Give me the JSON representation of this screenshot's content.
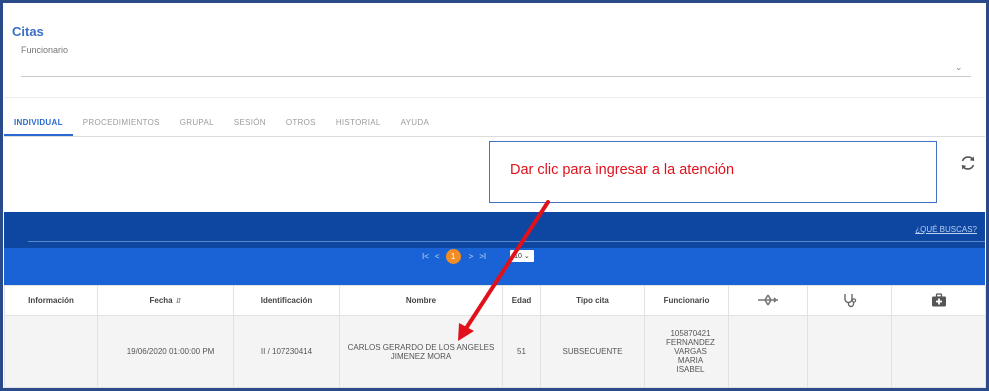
{
  "header": {
    "title": "Citas",
    "funcionario_label": "Funcionario"
  },
  "tabs": [
    {
      "label": "INDIVIDUAL",
      "active": true
    },
    {
      "label": "PROCEDIMIENTOS",
      "active": false
    },
    {
      "label": "GRUPAL",
      "active": false
    },
    {
      "label": "SESIÓN",
      "active": false
    },
    {
      "label": "OTROS",
      "active": false
    },
    {
      "label": "HISTORIAL",
      "active": false
    },
    {
      "label": "AYUDA",
      "active": false
    }
  ],
  "callout": {
    "text": "Dar clic para ingresar a la atención",
    "text_color": "#e0111b",
    "border_color": "#4472c4"
  },
  "icons": {
    "refresh": "refresh-icon",
    "plane": "plane-icon",
    "stethoscope": "stethoscope-icon",
    "medical_kit": "medical-kit-icon"
  },
  "banner": {
    "query_link": "¿QUÉ BUSCAS?",
    "color": "#0d47a1",
    "pager_color": "#1a63d6"
  },
  "pager": {
    "first": "I<",
    "prev": "<",
    "current": "1",
    "next": ">",
    "last": ">I",
    "page_size": "10",
    "accent": "#f48c24"
  },
  "table": {
    "columns": [
      "Información",
      "Fecha",
      "Identificación",
      "Nombre",
      "Edad",
      "Tipo cita",
      "Funcionario"
    ],
    "rows": [
      {
        "informacion": "",
        "fecha": "19/06/2020 01:00:00 PM",
        "identificacion": "II / 107230414",
        "nombre": "CARLOS GERARDO DE LOS ANGELES JIMENEZ MORA",
        "edad": "51",
        "tipo_cita": "SUBSECUENTE",
        "funcionario": [
          "105870421",
          "FERNANDEZ",
          "VARGAS",
          "MARIA",
          "ISABEL"
        ]
      }
    ]
  }
}
